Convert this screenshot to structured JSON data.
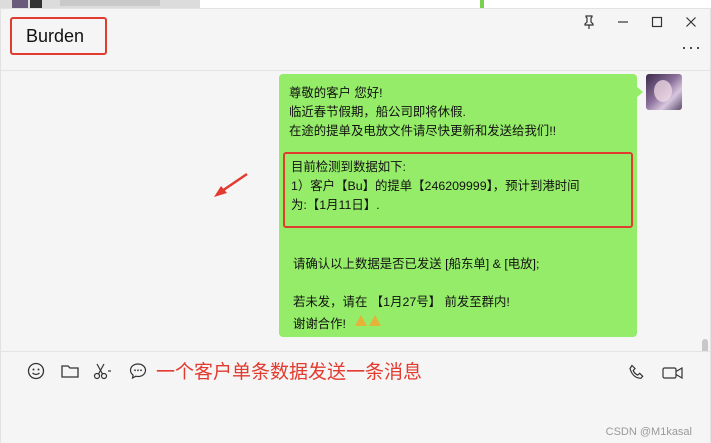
{
  "window": {
    "title": "Burden"
  },
  "controls": {
    "pin_icon": "pin-icon",
    "minimize_icon": "minimize-icon",
    "maximize_icon": "maximize-icon",
    "close_icon": "close-icon",
    "more_icon": "more-icon"
  },
  "message": {
    "lines_top": [
      "尊敬的客户 您好!",
      "临近春节假期，船公司即将休假.",
      "在途的提单及电放文件请尽快更新和发送给我们!!"
    ],
    "highlight_lines": [
      "目前检测到数据如下:",
      "1）客户【Bu】的提单【246209999】，预计到港时间",
      "为:【1月11日】."
    ],
    "lines_bottom": [
      "请确认以上数据是否已发送 [船东单] & [电放];",
      "",
      "若未发，请在 【1月27号】 前发至群内!",
      "谢谢合作!"
    ]
  },
  "toolbar": {
    "icons": [
      "emoji-icon",
      "folder-icon",
      "scissors-icon",
      "chat-bubble-icon"
    ],
    "right_icons": [
      "phone-icon",
      "video-icon"
    ]
  },
  "caption": "一个客户单条数据发送一条消息",
  "watermark": "CSDN @M1kasal",
  "colors": {
    "accent_red": "#e23b2f",
    "bubble_green": "#95ec69"
  }
}
